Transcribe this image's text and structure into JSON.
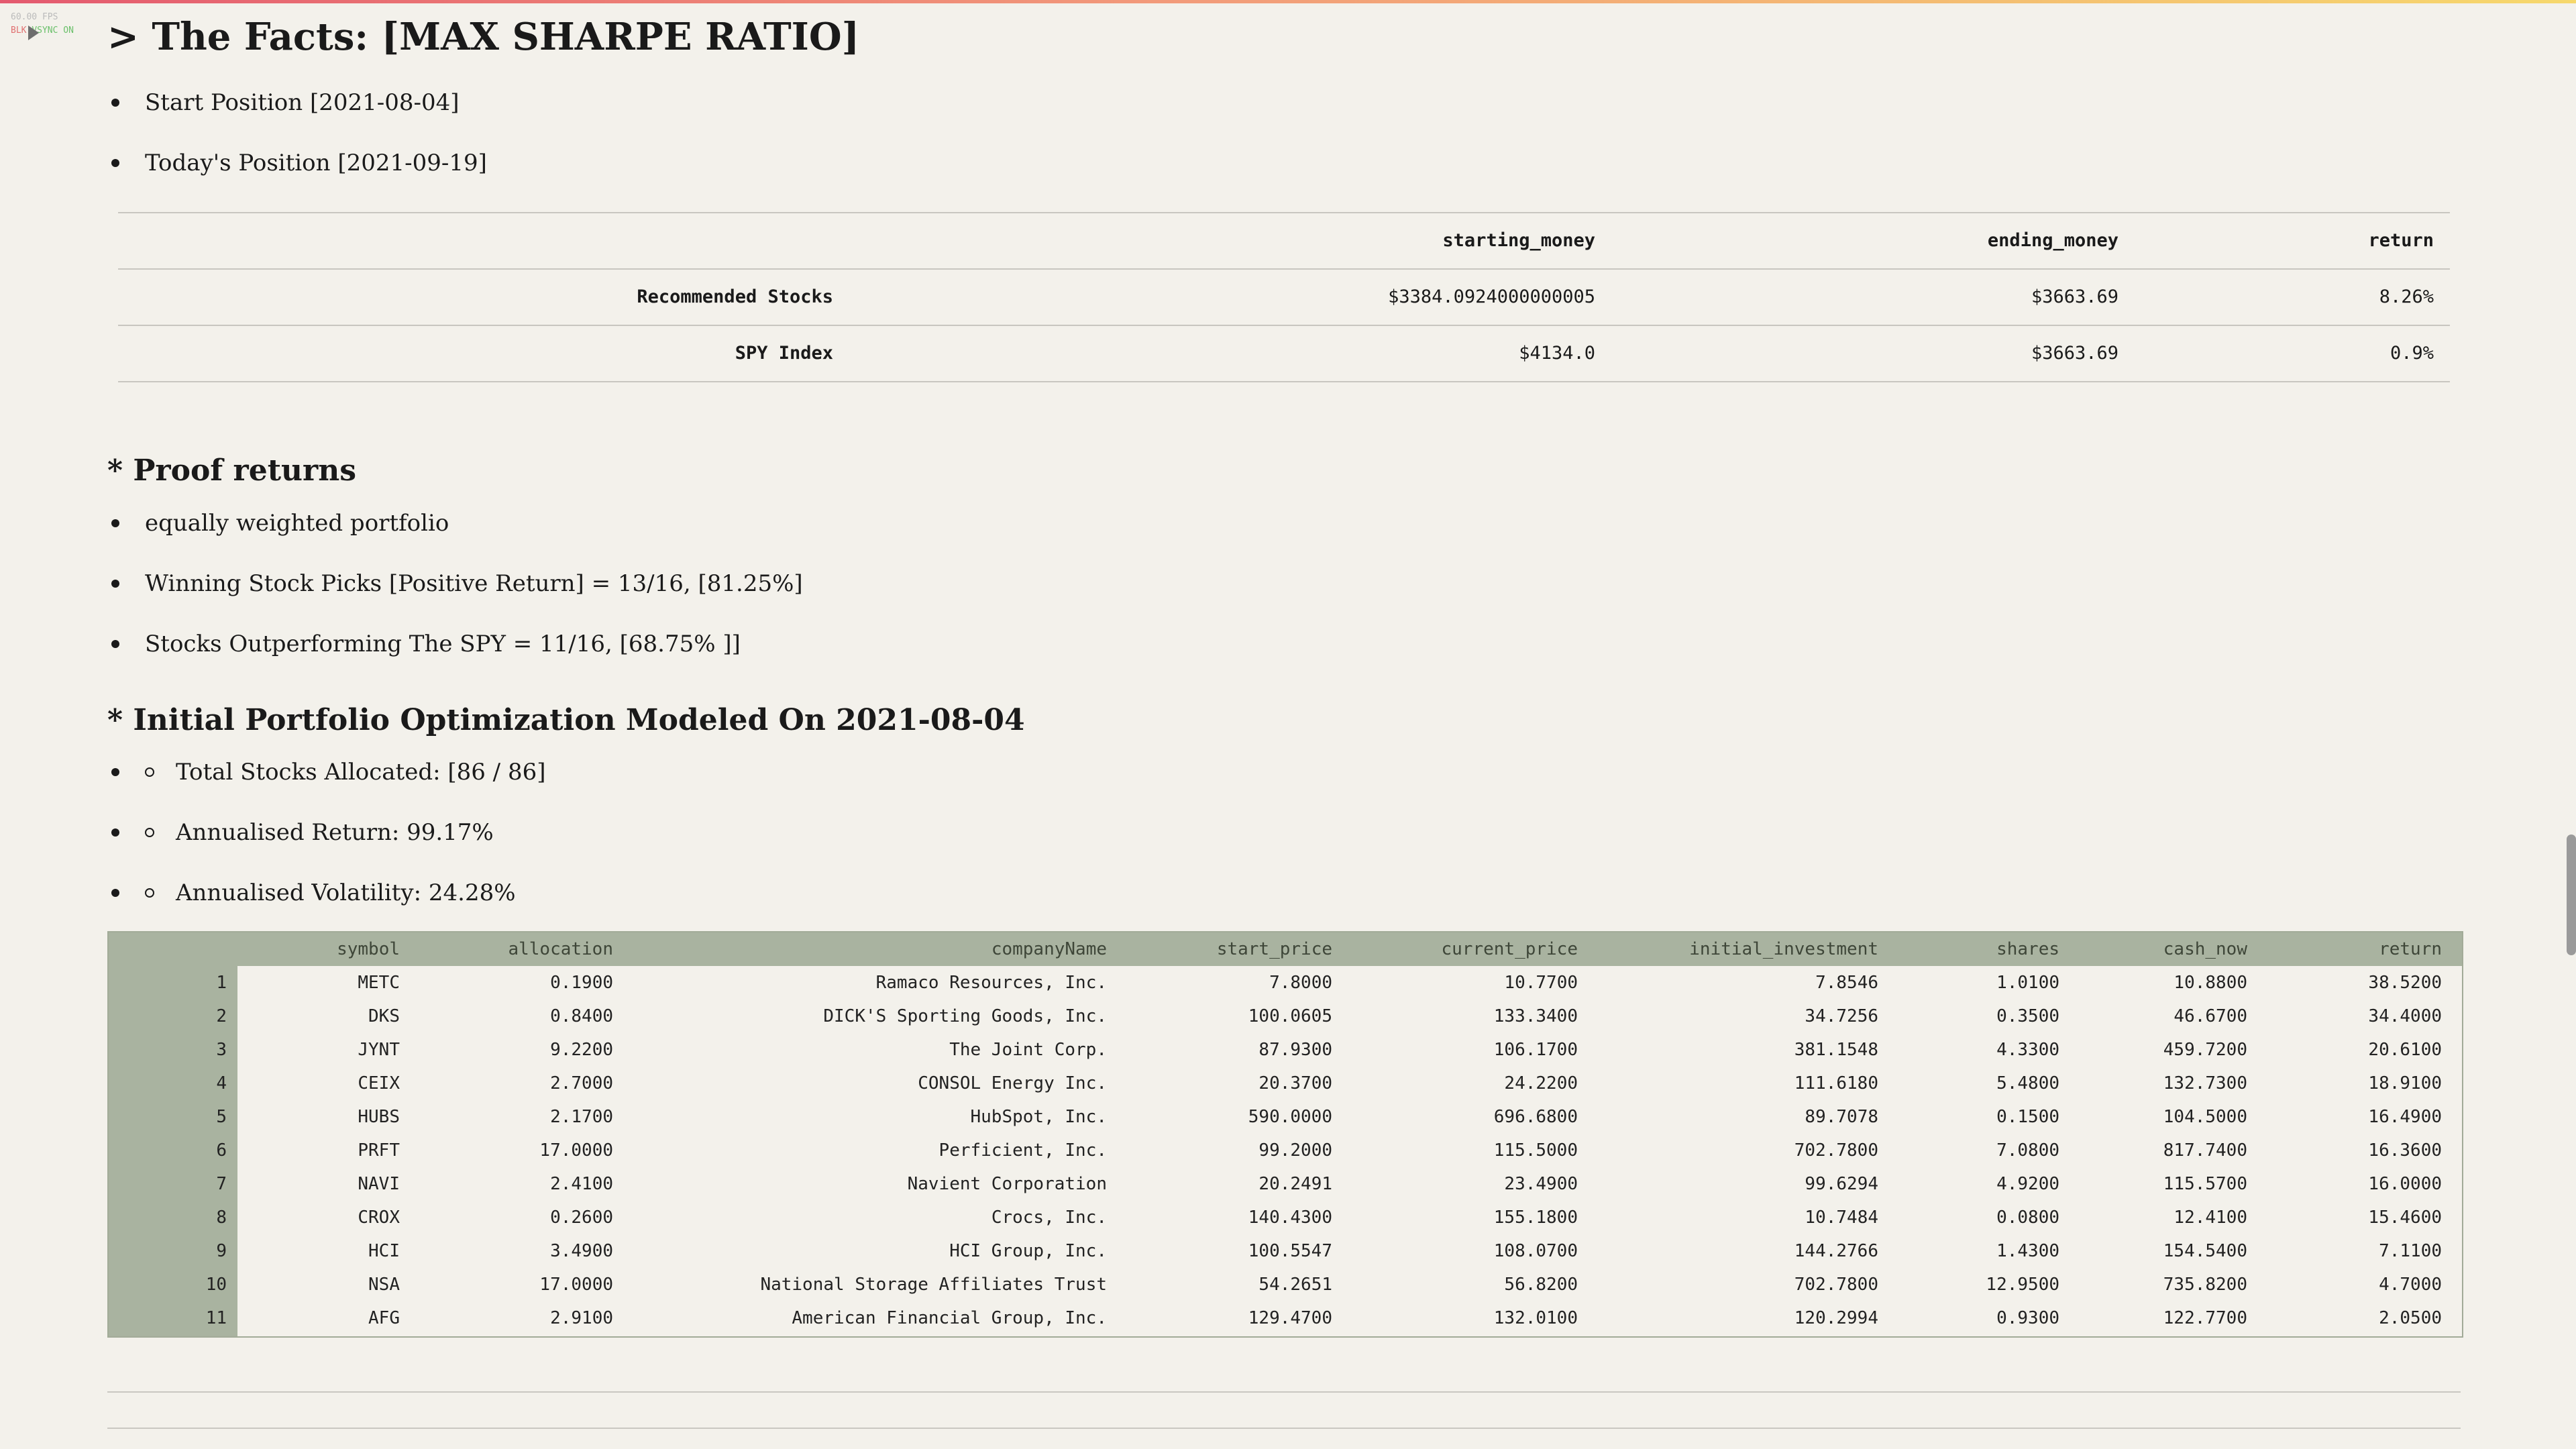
{
  "debug": {
    "fps": "60.00 FPS",
    "blk": "BLK",
    "vsync": "VSYNC ON"
  },
  "title": "> The Facts: [MAX SHARPE RATIO]",
  "facts_bullets": [
    "Start Position [2021-08-04]",
    "Today's Position [2021-09-19]"
  ],
  "facts_table": {
    "headers": [
      "",
      "starting_money",
      "ending_money",
      "return"
    ],
    "rows": [
      [
        "Recommended Stocks",
        "$3384.0924000000005",
        "$3663.69",
        "8.26%"
      ],
      [
        "SPY Index",
        "$4134.0",
        "$3663.69",
        "0.9%"
      ]
    ]
  },
  "proof": {
    "heading": "* Proof returns",
    "bullets": [
      "equally weighted portfolio",
      "Winning Stock Picks [Positive Return] = 13/16, [81.25%]",
      "Stocks Outperforming The SPY = 11/16, [68.75% ]]"
    ]
  },
  "optimization": {
    "heading": "* Initial Portfolio Optimization Modeled On 2021-08-04",
    "bullets": [
      "Total Stocks Allocated: [86 / 86]",
      "Annualised Return: 99.17%",
      "Annualised Volatility: 24.28%"
    ]
  },
  "portfolio_table": {
    "headers": [
      "",
      "symbol",
      "allocation",
      "companyName",
      "start_price",
      "current_price",
      "initial_investment",
      "shares",
      "cash_now",
      "return"
    ],
    "rows": [
      [
        "1",
        "METC",
        "0.1900",
        "Ramaco Resources, Inc.",
        "7.8000",
        "10.7700",
        "7.8546",
        "1.0100",
        "10.8800",
        "38.5200"
      ],
      [
        "2",
        "DKS",
        "0.8400",
        "DICK'S Sporting Goods, Inc.",
        "100.0605",
        "133.3400",
        "34.7256",
        "0.3500",
        "46.6700",
        "34.4000"
      ],
      [
        "3",
        "JYNT",
        "9.2200",
        "The Joint Corp.",
        "87.9300",
        "106.1700",
        "381.1548",
        "4.3300",
        "459.7200",
        "20.6100"
      ],
      [
        "4",
        "CEIX",
        "2.7000",
        "CONSOL Energy Inc.",
        "20.3700",
        "24.2200",
        "111.6180",
        "5.4800",
        "132.7300",
        "18.9100"
      ],
      [
        "5",
        "HUBS",
        "2.1700",
        "HubSpot, Inc.",
        "590.0000",
        "696.6800",
        "89.7078",
        "0.1500",
        "104.5000",
        "16.4900"
      ],
      [
        "6",
        "PRFT",
        "17.0000",
        "Perficient, Inc.",
        "99.2000",
        "115.5000",
        "702.7800",
        "7.0800",
        "817.7400",
        "16.3600"
      ],
      [
        "7",
        "NAVI",
        "2.4100",
        "Navient Corporation",
        "20.2491",
        "23.4900",
        "99.6294",
        "4.9200",
        "115.5700",
        "16.0000"
      ],
      [
        "8",
        "CROX",
        "0.2600",
        "Crocs, Inc.",
        "140.4300",
        "155.1800",
        "10.7484",
        "0.0800",
        "12.4100",
        "15.4600"
      ],
      [
        "9",
        "HCI",
        "3.4900",
        "HCI Group, Inc.",
        "100.5547",
        "108.0700",
        "144.2766",
        "1.4300",
        "154.5400",
        "7.1100"
      ],
      [
        "10",
        "NSA",
        "17.0000",
        "National Storage Affiliates Trust",
        "54.2651",
        "56.8200",
        "702.7800",
        "12.9500",
        "735.8200",
        "4.7000"
      ],
      [
        "11",
        "AFG",
        "2.9100",
        "American Financial Group, Inc.",
        "129.4700",
        "132.0100",
        "120.2994",
        "0.9300",
        "122.7700",
        "2.0500"
      ]
    ]
  },
  "colors": {
    "background": "#f3f1eb",
    "table_header": "#a9b3a0",
    "accent_gradient": [
      "#e45a6f",
      "#f6d86c"
    ]
  },
  "icons": {
    "cell_toggle": "caret-right-icon"
  }
}
